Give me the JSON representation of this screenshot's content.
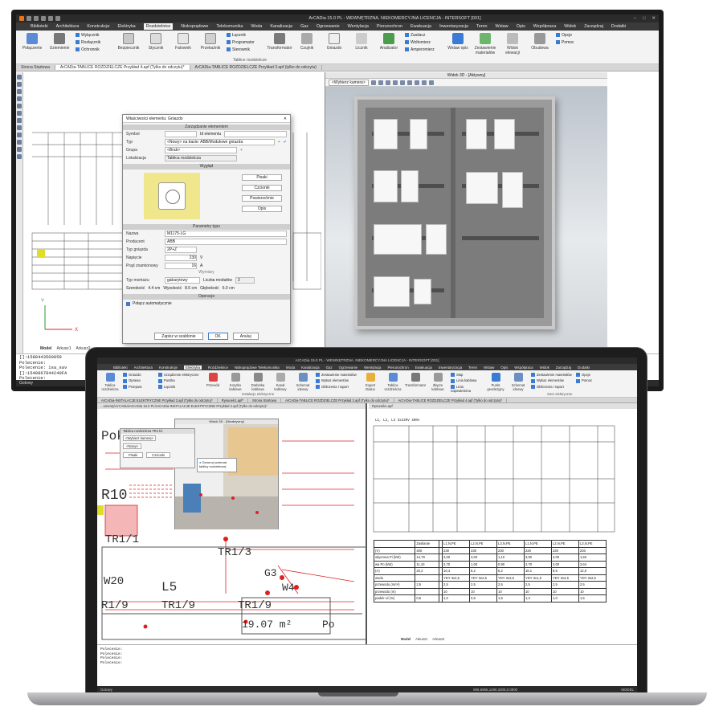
{
  "monitor": {
    "window_title": "ArCADia 15.0 PL - WEWNĘTRZNA, NIEKOMERCYJNA LICENCJA - INTERSOFT [001]",
    "menu": [
      "Biblioteki",
      "Architektura",
      "Konstrukcje",
      "Elektryka",
      "Rozdzielnice",
      "Niskoprądowe",
      "Telekomunika",
      "Woda",
      "Kanalizacja",
      "Gaz",
      "Ogrzewanie",
      "Wentylacja",
      "Pierunochron",
      "Ewakuacja",
      "Inwentaryzacja",
      "Teren",
      "Wstaw",
      "Opis",
      "Współpraca",
      "Widok",
      "Zarządzaj",
      "Dodatki"
    ],
    "active_menu": "Rozdzielnice",
    "ribbon": {
      "buttons": [
        "Połączenie",
        "Uziemienie",
        "Bezpiecznik",
        "Stycznik",
        "Falownik",
        "Przekaźnik",
        "Transformator",
        "Czujnik",
        "Gniazdo",
        "Licznik",
        "Analizator",
        "Wstaw opis",
        "Zestawienie materiałów",
        "Widok elewacji",
        "Obudowa"
      ],
      "small1": [
        "Wyłącznik",
        "Rozłącznik",
        "Ochronnik"
      ],
      "small2": [
        "Łącznik",
        "Programator",
        "Sterownik"
      ],
      "small3": [
        "Zasilacz",
        "Woltomierz",
        "Amperomierz"
      ],
      "small4": [
        "Opcje",
        "Pomoc"
      ],
      "group_label": "Tablice rozdzielcze"
    },
    "doc_tabs": [
      "Strona Startowa",
      "ArCADia-TABLICE ROZDZIELCZE Przykład 4.apf (Tylko do odczytu)*",
      "ArCADia-TABLICE ROZDZIELCZE Przykład 3.apf (tylko do odczytu)"
    ],
    "dialog": {
      "title": "Właściwości elementu: Gniazdo",
      "sec_manage": "Zarządzanie elementem",
      "symbol_label": "Symbol",
      "id_label": "Id elementu",
      "typ_label": "Typ",
      "typ_value": "<Nowy> na bazie: ABB/Modułowe gniazda",
      "grupa_label": "Grupa",
      "grupa_value": "<Brak>",
      "lok_label": "Lokalizacja",
      "lok_value": "Tablica rozdzielcza",
      "sec_look": "Wygląd",
      "look_buttons": [
        "Pisaki",
        "Czcionki",
        "Powierzchnie",
        "Opis"
      ],
      "sec_params": "Parametry typu",
      "nazwa_label": "Nazwa",
      "nazwa_value": "M1175-LG",
      "producent_label": "Producent",
      "producent_value": "ABB",
      "typ_gniazda_label": "Typ gniazda",
      "typ_gniazda_value": "2P+Z",
      "napiecie_label": "Napięcie",
      "napiecie_value": "230",
      "napiecie_unit": "V",
      "prad_label": "Prąd znamionowy",
      "prad_value": "16",
      "prad_unit": "A",
      "wymiary_label": "Wymiary",
      "montaz_label": "Typ montażu",
      "montaz_value": "gabarytowy",
      "moduly_label": "Liczba modułów",
      "moduly_value": "3",
      "szer_label": "Szerokość",
      "szer_value": "4.4 cm",
      "wys_label": "Wysokość",
      "wys_value": "8.5 cm",
      "gl_label": "Głębokość",
      "gl_value": "6.0 cm",
      "sec_ops": "Operacje",
      "auto_label": "Połącz automatycznie",
      "save_template": "Zapisz w szablonie",
      "ok": "OK",
      "cancel": "Anuluj"
    },
    "view3d": {
      "title": "Widok 3D - [Aktywny]",
      "camera": "<Wybierz kamerę>"
    },
    "sheet_tabs": [
      "Model",
      "Arkusz1",
      "Arkusz2"
    ],
    "cmd_lines": [
      "[]:1588443500059",
      "Polecenie:",
      "Polecenie: isa_sav",
      "[]:1548867844240FA",
      "Polecenie:"
    ],
    "status": "Gotowy"
  },
  "laptop": {
    "window_title": "ArCADia 15.0 PL - WEWNĘTRZNA, NIEKOMERCYJNA LICENCJA - INTERSOFT [001]",
    "menu": [
      "Biblioteki",
      "Architektura",
      "Konstrukcje",
      "Elektryka",
      "Rozdzielnice",
      "Niskoprądowe Telekomunika",
      "Woda",
      "Kanalizacja",
      "Gaz",
      "Ogrzewanie",
      "Wentylacja",
      "Pierunochron",
      "Ewakuacja",
      "Inwentaryzacja",
      "Teren",
      "Wstaw",
      "Opis",
      "Współpraca",
      "Widok",
      "Zarządzaj",
      "Dodatki"
    ],
    "active_menu": "Elektryka",
    "ribbon": {
      "buttons": [
        "Tablica rozdzielcza",
        "Przewód",
        "Korytko kablowe",
        "Drabinka kablowa",
        "Kanał kablowy",
        "Schemat ideowy",
        "Export Dialux",
        "Tablica rozdzielcza",
        "Transformator",
        "Złącze kablowe",
        "Punkt geodezyjny",
        "Schemat ideowy"
      ],
      "small1": [
        "Gniazdo",
        "Oprawa",
        "Przepust"
      ],
      "small2": [
        "Urządzenie elektryczne",
        "Puszka",
        "Łącznik"
      ],
      "small3": [
        "Zestawienie materiałów",
        "Wykaz elementów",
        "Obliczenia i raport"
      ],
      "small4": [
        "Słup",
        "Linia kablowa",
        "Linia napowietrzna"
      ],
      "small5": [
        "Zestawienie materiałów",
        "Wykaz elementów",
        "Obliczenia i raport"
      ],
      "small6": [
        "Opcje",
        "Pomoc"
      ],
      "group_label": "Instalacje elektryczne",
      "group_label2": "Sieci elektryczne"
    },
    "doc_tabs": [
      "ArCADia-INSTALACJE ELEKTRYCZNE Przykład 2.apf (Tylko do odczytu)*",
      "Rysunek1.apf*",
      "Strona Startowa",
      "ArCADia-TABLICE ROZDZIELCZE Przykład 2.apf (Tylko do odczytu)*",
      "ArCADia-TABLICE ROZDZIELCZE Przykład 4.apf (Tylko do odczytu)*"
    ],
    "left_sub": "...umenty\\ArCADia\\ArCADia 15.0 PL\\ArCADia-INSTALACJE ELEKTRYCZNE Przykład 2.apf (Tylko do odczytu)*",
    "right_sub": "Rysunek1.apf",
    "plan3d_title": "Widok 3D - [Nieaktywny]",
    "mini_dlg_title": "Tablica rozdzielcza TR1 bl.",
    "mini_dlg_camera": "<Wybierz kamerę>",
    "mini_dlg_new": "<Nowy>",
    "mini_dlg_btns": [
      "Pisaki",
      "Czcionki"
    ],
    "tooltip": "Generuj schemat tablicy rozdzielczej",
    "plan_labels": [
      "Poko",
      "R10",
      "TR1/1",
      "TR1/3",
      "G3",
      "W20",
      "L5",
      "W4",
      "R1/9",
      "TR1/9",
      "TR1/9",
      "19.07 m²",
      "Po"
    ],
    "sheet_header": "L1, L2, L3  3x230V  400A",
    "table_rows": [
      [
        "",
        "Zasilanie",
        "",
        "L1,N,PE",
        "L2,N,PE",
        "L3,N,PE",
        "L1,N,PE",
        "L2,N,PE",
        "L3,N,PE"
      ],
      [
        "(V)",
        "400",
        "",
        "230",
        "230",
        "230",
        "230",
        "230",
        "230"
      ],
      [
        "ołączona Pi (kW)",
        "14,79",
        "",
        "3,00",
        "3,00",
        "1,10",
        "3,00",
        "3,00",
        "1,50"
      ],
      [
        "wa Po (kW)",
        "11,10",
        "",
        "2,70",
        "1,00",
        "0,90",
        "2,70",
        "3,00",
        "2,64"
      ],
      [
        "(A)",
        "20,2",
        "",
        "10,4",
        "8,2",
        "6,2",
        "18,1",
        "8,5",
        "12,0"
      ],
      [
        "wodu",
        "",
        "",
        "YDY 3x2,5",
        "YDY 3x2,5",
        "YDY 3x2,5",
        "YDY 3x1,5",
        "YDY 3x2,5",
        "YDY 3x2,5"
      ],
      [
        "przewodu (mm²)",
        "2,5",
        "",
        "2,5",
        "2,5",
        "2,5",
        "2,5",
        "2,5",
        "2,5"
      ],
      [
        "przewodu (m)",
        "",
        "",
        "10",
        "10",
        "10",
        "10",
        "10",
        "10"
      ],
      [
        "padek Ui (%)",
        "0,5",
        "",
        "1,0",
        "0,6",
        "1,5",
        "1,3",
        "1,0",
        "1,5"
      ]
    ],
    "sheet_tabs": [
      "Model",
      "Layout1",
      "Layout2"
    ],
    "sheet_tabs_right": [
      "Model",
      "Arkusz1",
      "Arkusz2"
    ],
    "cmd_lines": [
      "Polecenie:",
      "Polecenie:",
      "Polecenie:",
      "Polecenie:"
    ],
    "status": "Gotowy",
    "coords": "905.6955,1490.3205,0.0000",
    "status_right": "MODEL"
  },
  "colors": {
    "accent": "#3a7bd5",
    "dark_chrome": "#2b2b2b",
    "plan_red": "#e02020",
    "wall_tan": "#d9d2c6"
  }
}
